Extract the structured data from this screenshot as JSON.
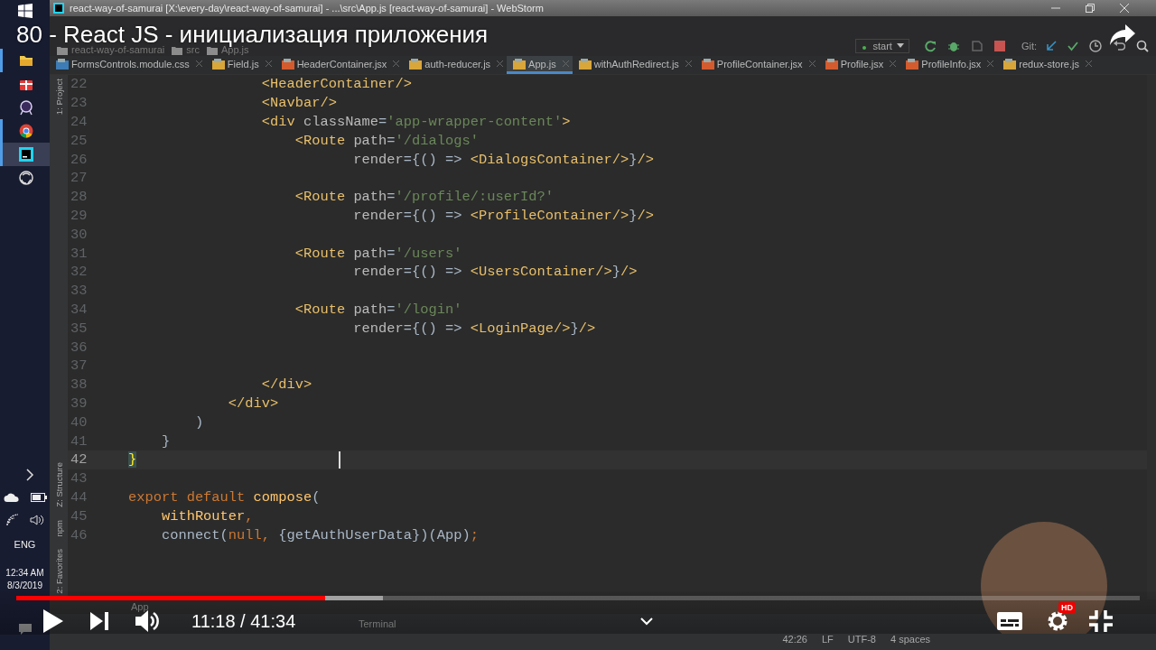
{
  "taskbar": {
    "apps": [
      {
        "kind": "folder",
        "running": true,
        "selected": false
      },
      {
        "kind": "gift",
        "running": false,
        "selected": false
      },
      {
        "kind": "bubble",
        "running": false,
        "selected": false
      },
      {
        "kind": "chrome",
        "running": true,
        "selected": false
      },
      {
        "kind": "webstorm",
        "running": true,
        "selected": true
      },
      {
        "kind": "record",
        "running": false,
        "selected": false
      }
    ],
    "language": "ENG",
    "time": "12:34 AM",
    "date": "8/3/2019"
  },
  "ide": {
    "window_title": "react-way-of-samurai [X:\\every-day\\react-way-of-samurai] - ...\\src\\App.js [react-way-of-samurai] - WebStorm",
    "breadcrumbs": [
      "react-way-of-samurai",
      "src",
      "App.js"
    ],
    "run_config": "start",
    "git_label": "Git:",
    "tabs": [
      {
        "label": "FormsControls.module.css",
        "kind": "css",
        "selected": false
      },
      {
        "label": "Field.js",
        "kind": "js",
        "selected": false
      },
      {
        "label": "HeaderContainer.jsx",
        "kind": "jsx",
        "selected": false
      },
      {
        "label": "auth-reducer.js",
        "kind": "js",
        "selected": false
      },
      {
        "label": "App.js",
        "kind": "js",
        "selected": true
      },
      {
        "label": "withAuthRedirect.js",
        "kind": "js",
        "selected": false
      },
      {
        "label": "ProfileContainer.jsx",
        "kind": "jsx",
        "selected": false
      },
      {
        "label": "Profile.jsx",
        "kind": "jsx",
        "selected": false
      },
      {
        "label": "ProfileInfo.jsx",
        "kind": "jsx",
        "selected": false
      },
      {
        "label": "redux-store.js",
        "kind": "js",
        "selected": false
      }
    ],
    "side_tools_top": [
      "1: Project"
    ],
    "side_tools_bottom": [
      "Z: Structure",
      "npm",
      "2: Favorites"
    ],
    "lines": [
      {
        "number": "22",
        "current": false,
        "tokens": [
          {
            "kind": "tag",
            "text": "                <HeaderContainer/>"
          }
        ]
      },
      {
        "number": "23",
        "current": false,
        "tokens": [
          {
            "kind": "tag",
            "text": "                <Navbar/>"
          }
        ]
      },
      {
        "number": "24",
        "current": false,
        "tokens": [
          {
            "kind": "tag",
            "text": "                <div"
          },
          {
            "kind": "attr",
            "text": " className"
          },
          {
            "kind": "plain",
            "text": "="
          },
          {
            "kind": "string",
            "text": "'app-wrapper-content'"
          },
          {
            "kind": "tag",
            "text": ">"
          }
        ]
      },
      {
        "number": "25",
        "current": false,
        "tokens": [
          {
            "kind": "tag",
            "text": "                    <Route"
          },
          {
            "kind": "attr",
            "text": " path"
          },
          {
            "kind": "plain",
            "text": "="
          },
          {
            "kind": "string",
            "text": "'/dialogs'"
          }
        ]
      },
      {
        "number": "26",
        "current": false,
        "tokens": [
          {
            "kind": "attr",
            "text": "                           render"
          },
          {
            "kind": "plain",
            "text": "={() => "
          },
          {
            "kind": "tag",
            "text": "<DialogsContainer/>"
          },
          {
            "kind": "plain",
            "text": "}"
          },
          {
            "kind": "tag",
            "text": "/>"
          }
        ]
      },
      {
        "number": "27",
        "current": false
      },
      {
        "number": "28",
        "current": false,
        "tokens": [
          {
            "kind": "tag",
            "text": "                    <Route"
          },
          {
            "kind": "attr",
            "text": " path"
          },
          {
            "kind": "plain",
            "text": "="
          },
          {
            "kind": "string",
            "text": "'/profile/:userId?'"
          }
        ]
      },
      {
        "number": "29",
        "current": false,
        "tokens": [
          {
            "kind": "attr",
            "text": "                           render"
          },
          {
            "kind": "plain",
            "text": "={() => "
          },
          {
            "kind": "tag",
            "text": "<ProfileContainer/>"
          },
          {
            "kind": "plain",
            "text": "}"
          },
          {
            "kind": "tag",
            "text": "/>"
          }
        ]
      },
      {
        "number": "30",
        "current": false
      },
      {
        "number": "31",
        "current": false,
        "tokens": [
          {
            "kind": "tag",
            "text": "                    <Route"
          },
          {
            "kind": "attr",
            "text": " path"
          },
          {
            "kind": "plain",
            "text": "="
          },
          {
            "kind": "string",
            "text": "'/users'"
          }
        ]
      },
      {
        "number": "32",
        "current": false,
        "tokens": [
          {
            "kind": "attr",
            "text": "                           render"
          },
          {
            "kind": "plain",
            "text": "={() => "
          },
          {
            "kind": "tag",
            "text": "<UsersContainer/>"
          },
          {
            "kind": "plain",
            "text": "}"
          },
          {
            "kind": "tag",
            "text": "/>"
          }
        ]
      },
      {
        "number": "33",
        "current": false
      },
      {
        "number": "34",
        "current": false,
        "tokens": [
          {
            "kind": "tag",
            "text": "                    <Route"
          },
          {
            "kind": "attr",
            "text": " path"
          },
          {
            "kind": "plain",
            "text": "="
          },
          {
            "kind": "string",
            "text": "'/login'"
          }
        ]
      },
      {
        "number": "35",
        "current": false,
        "tokens": [
          {
            "kind": "attr",
            "text": "                           render"
          },
          {
            "kind": "plain",
            "text": "={() => "
          },
          {
            "kind": "tag",
            "text": "<LoginPage/>"
          },
          {
            "kind": "plain",
            "text": "}"
          },
          {
            "kind": "tag",
            "text": "/>"
          }
        ]
      },
      {
        "number": "36",
        "current": false
      },
      {
        "number": "37",
        "current": false
      },
      {
        "number": "38",
        "current": false,
        "tokens": [
          {
            "kind": "tag",
            "text": "                </div>"
          }
        ]
      },
      {
        "number": "39",
        "current": false,
        "tokens": [
          {
            "kind": "tag",
            "text": "            </div>"
          }
        ]
      },
      {
        "number": "40",
        "current": false,
        "tokens": [
          {
            "kind": "plain",
            "text": "        )"
          }
        ]
      },
      {
        "number": "41",
        "current": false,
        "tokens": [
          {
            "kind": "plain",
            "text": "    }"
          }
        ]
      },
      {
        "number": "42",
        "current": true,
        "tokens": [
          {
            "kind": "brace",
            "text": "}"
          }
        ]
      },
      {
        "number": "43",
        "current": false
      },
      {
        "number": "44",
        "current": false,
        "tokens": [
          {
            "kind": "keyword",
            "text": "export default "
          },
          {
            "kind": "func",
            "text": "compose"
          },
          {
            "kind": "plain",
            "text": "("
          }
        ]
      },
      {
        "number": "45",
        "current": false,
        "tokens": [
          {
            "kind": "func",
            "text": "    withRouter"
          },
          {
            "kind": "keyword",
            "text": ","
          }
        ]
      },
      {
        "number": "46",
        "current": false,
        "tokens": [
          {
            "kind": "plain",
            "text": "    connect("
          },
          {
            "kind": "keyword",
            "text": "null, "
          },
          {
            "kind": "plain",
            "text": "{getAuthUserData})(App)"
          },
          {
            "kind": "keyword",
            "text": ";"
          }
        ]
      }
    ],
    "footer_breadcrumb": "App",
    "tool_windows": [
      "Terminal"
    ],
    "status": [
      "42:26",
      "LF",
      "UTF-8",
      "4 spaces"
    ]
  },
  "video": {
    "title": "80 - React JS - инициализация приложения",
    "progress": {
      "level": 0.275,
      "buffer": {
        "level": 0.326
      }
    },
    "time": "11:18 / 41:34",
    "hd_badge": "HD"
  }
}
